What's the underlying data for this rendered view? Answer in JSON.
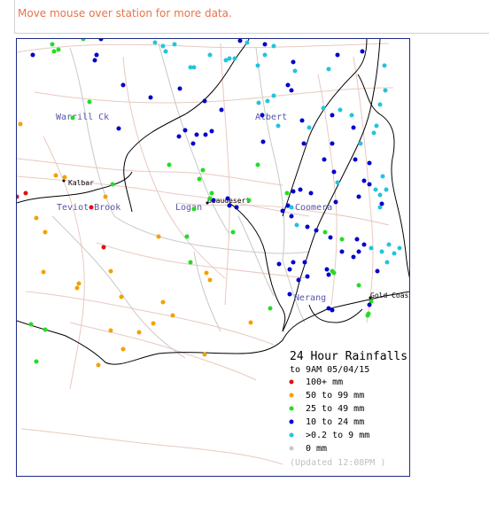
{
  "hint": "Move mouse over station for more data.",
  "regions": [
    "Warrill Ck",
    "Albert",
    "Teviot Brook",
    "Logan",
    "Coomera",
    "Nerang"
  ],
  "towns": [
    "Kalbar",
    "Beaudesert",
    "Gold Coast"
  ],
  "legend": {
    "title": "24 Hour Rainfalls",
    "subtitle": "to 9AM 05/04/15",
    "items": [
      {
        "label": "100+ mm",
        "color": "#dd1111"
      },
      {
        "label": "50  to 99 mm",
        "color": "#f5a000"
      },
      {
        "label": "25  to 49 mm",
        "color": "#22dd22"
      },
      {
        "label": "10  to 24 mm",
        "color": "#0000cc"
      },
      {
        "label": ">0.2 to 9 mm",
        "color": "#22c4dd"
      },
      {
        "label": "0 mm",
        "color": "#c8c8c8"
      }
    ],
    "updated": "(Updated 12:08PM  )"
  },
  "colors": {
    "red": "#dd1111",
    "orange": "#f5a000",
    "green": "#22dd22",
    "blue": "#0000cc",
    "cyan": "#22c4dd",
    "roads": "#e8c9c0",
    "rivers": "#c8c8c8",
    "border": "#000000"
  }
}
